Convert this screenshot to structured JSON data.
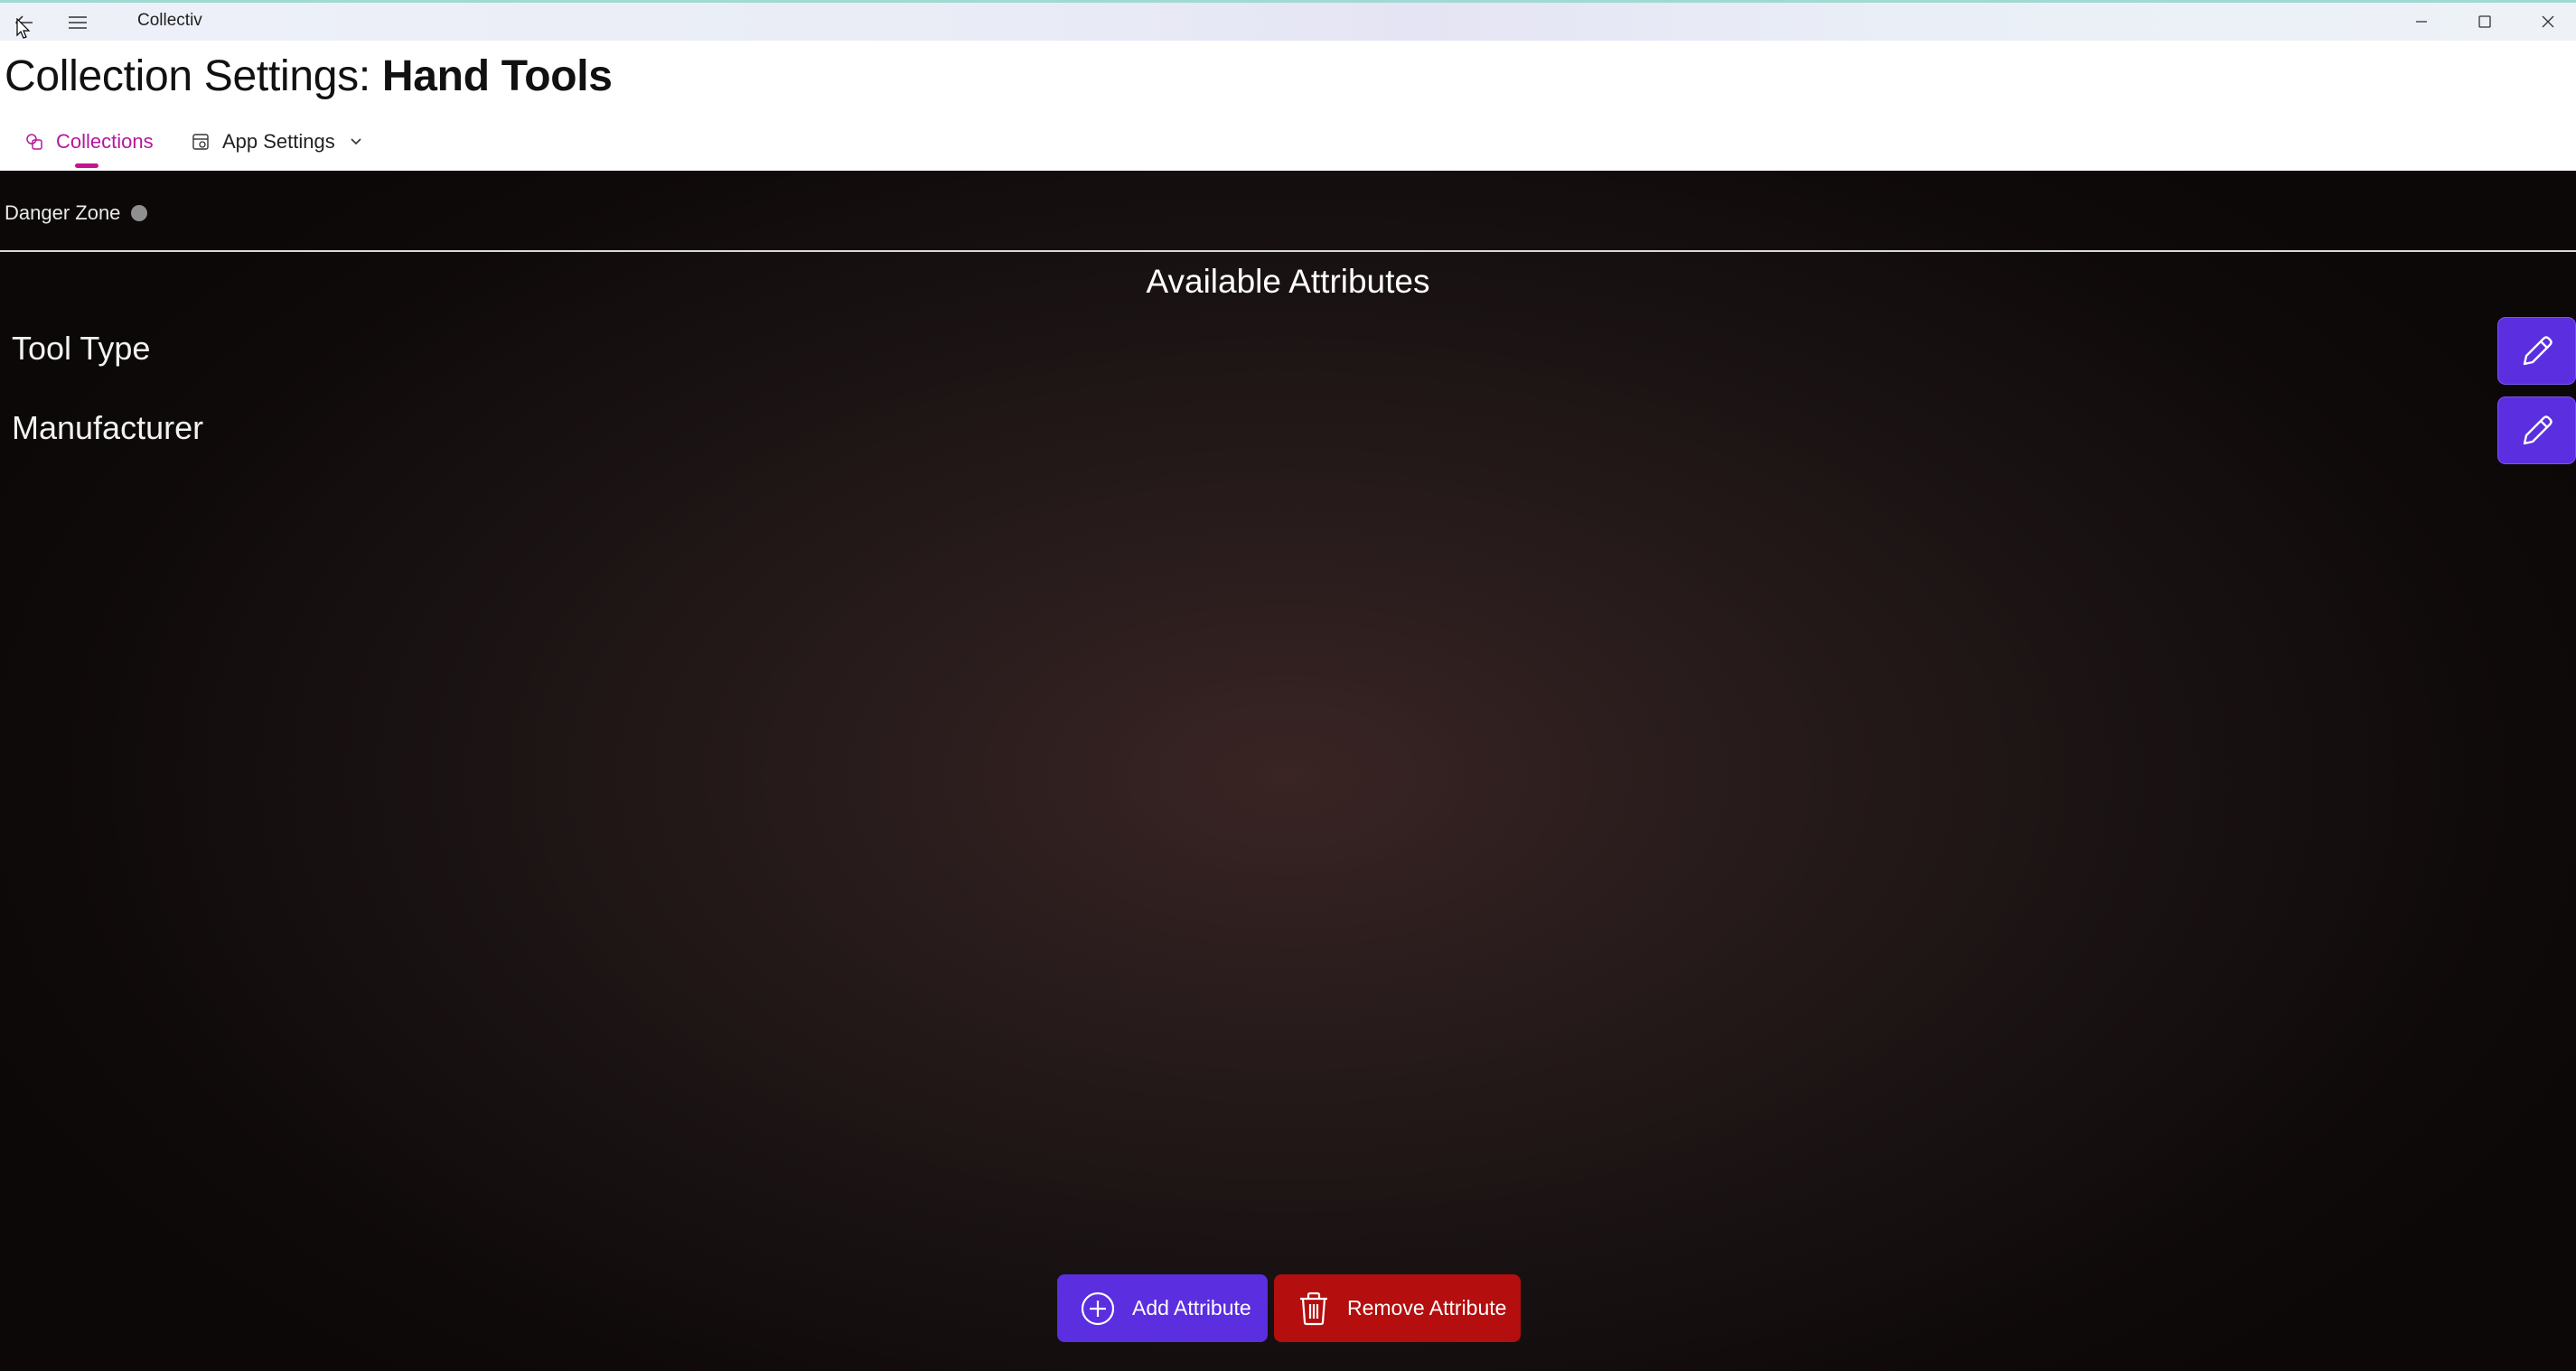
{
  "window": {
    "app_title": "Collectiv",
    "icons": {
      "back": "back-arrow-icon",
      "menu": "hamburger-menu-icon",
      "minimize": "minimize-icon",
      "maximize": "maximize-icon",
      "close": "close-icon"
    }
  },
  "header": {
    "title_prefix": "Collection Settings: ",
    "title_collection": "Hand Tools",
    "tabs": [
      {
        "label": "Collections",
        "icon": "collections-icon",
        "selected": true
      },
      {
        "label": "App Settings",
        "icon": "app-settings-icon",
        "has_dropdown": true
      }
    ],
    "accent_color": "#c2158f"
  },
  "main": {
    "danger_zone_label": "Danger Zone",
    "danger_zone_toggle_on": false,
    "section_title": "Available Attributes",
    "attributes": [
      {
        "name": "Tool Type",
        "action_icon": "pencil-edit-icon"
      },
      {
        "name": "Manufacturer",
        "action_icon": "pencil-edit-icon"
      }
    ],
    "buttons": {
      "add_label": "Add Attribute",
      "add_icon": "plus-circle-icon",
      "remove_label": "Remove Attribute",
      "remove_icon": "trash-icon"
    },
    "colors": {
      "primary": "#5b2ee0",
      "danger": "#b40e0e",
      "background": "#1c1414"
    }
  }
}
